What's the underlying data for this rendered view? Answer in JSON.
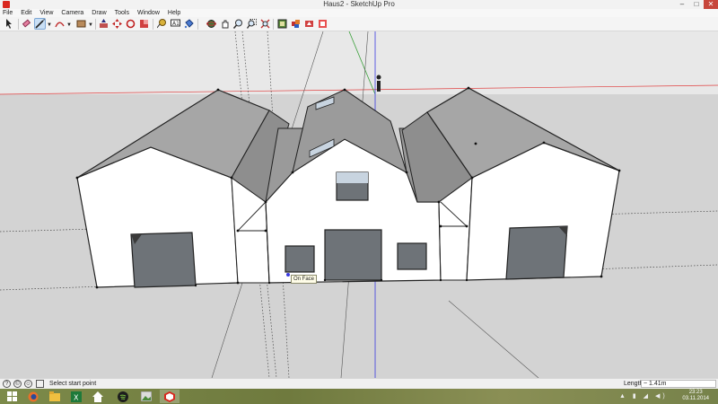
{
  "window": {
    "title": "Haus2 - SketchUp Pro",
    "controls": {
      "minimize": "–",
      "maximize": "□",
      "close": "✕"
    }
  },
  "menu": [
    "File",
    "Edit",
    "View",
    "Camera",
    "Draw",
    "Tools",
    "Window",
    "Help"
  ],
  "toolbar": {
    "tools": [
      "select-icon",
      "eraser-icon",
      "line-icon",
      "arc-icon",
      "rectangle-icon",
      "push-pull-icon",
      "move-icon",
      "rotate-icon",
      "scale-icon",
      "tape-measure-icon",
      "text-icon",
      "paint-bucket-icon",
      "orbit-icon",
      "pan-icon",
      "zoom-icon",
      "zoom-window-icon",
      "zoom-extents-icon",
      "warehouse-icon",
      "extension-warehouse-icon",
      "share-model-icon",
      "layout-icon"
    ],
    "active_tool": "line-icon"
  },
  "viewport": {
    "inference_tooltip": "On Face",
    "colors": {
      "wall": "#ffffff",
      "roof": "#a6a6a6",
      "roof_dark": "#8e8e8e",
      "opening": "#6e7378",
      "sky": "#e8e8e8",
      "ground": "#d3d3d3",
      "red_axis": "#e04040",
      "green_axis": "#3aa03a",
      "blue_axis": "#3a3ae0"
    }
  },
  "status": {
    "hint": "Select start point",
    "measure_label": "Length",
    "measure_value": "~ 1.41m",
    "icons": [
      "geolocation-icon",
      "credits-icon",
      "user-icon"
    ]
  },
  "taskbar": {
    "apps": [
      "windows-start-icon",
      "firefox-icon",
      "file-explorer-icon",
      "excel-icon",
      "home-icon",
      "spotify-icon",
      "pictures-icon",
      "sketchup-icon"
    ],
    "active_app": "sketchup-icon",
    "time": "23:23",
    "date": "03.11.2014"
  }
}
